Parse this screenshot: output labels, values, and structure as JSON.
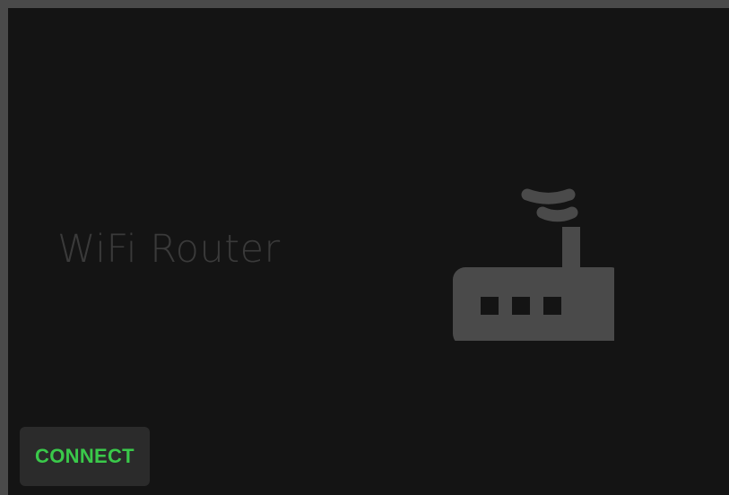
{
  "card": {
    "title": "WiFi Router",
    "icon": "wifi-router-icon",
    "connect_label": "CONNECT"
  },
  "colors": {
    "background": "#141414",
    "border": "#4a4a4a",
    "title": "#3a3a3a",
    "icon": "#4a4a4a",
    "button_background": "#2b2b2b",
    "button_text": "#3ac94a"
  }
}
